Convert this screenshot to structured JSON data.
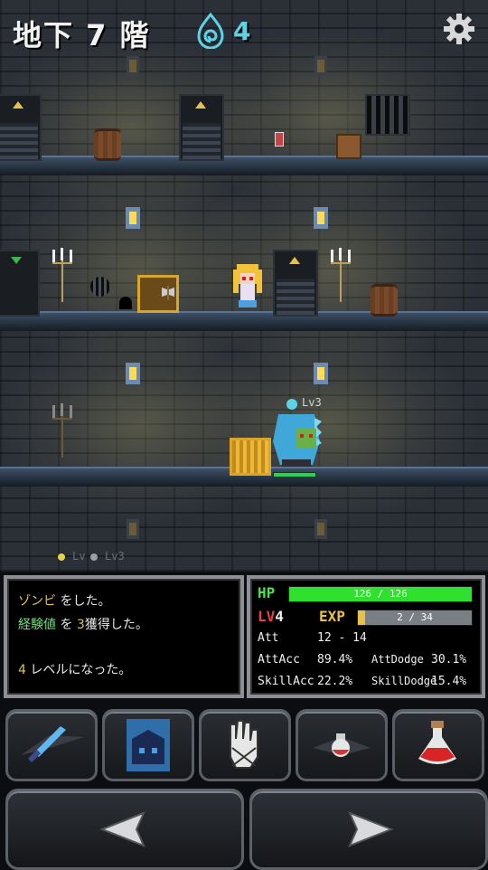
{
  "header": {
    "floor_title": "地下 7 階",
    "soul_icon": "spiral-soul-icon",
    "soul_count": "4",
    "settings_icon": "gear-icon"
  },
  "scene": {
    "enemy_label": "Lv3",
    "ghost_label_a": "Lv",
    "ghost_label_b": "Lv3"
  },
  "log": {
    "line1_name": "ゾンビ",
    "line1_rest": " をした。",
    "line2_a": "経験値",
    "line2_b": " を ",
    "line2_num": "3",
    "line2_c": "獲得した。",
    "line3_num": "4",
    "line3_rest": " レベルになった。"
  },
  "stats": {
    "hp_label": "HP",
    "hp_text": "126 / 126",
    "hp_fraction": 1.0,
    "lv_label": "LV",
    "lv_value": "4",
    "exp_label": "EXP",
    "exp_text": "2 / 34",
    "exp_fraction": 0.06,
    "att_label": "Att",
    "att_value": "12 - 14",
    "attacc_label": "AttAcc",
    "attacc_value": "89.4%",
    "attdodge_label": "AttDodge",
    "attdodge_value": "30.1%",
    "skillacc_label": "SkillAcc",
    "skillacc_value": "22.2%",
    "skilldodge_label": "SkillDodge",
    "skilldodge_value": "15.4%"
  },
  "colors": {
    "hp_green": "#2fe02f",
    "exp_bar_bg": "#7a7f85",
    "exp_fill": "#e6c24a",
    "soul_cyan": "#5fd3e6"
  },
  "slots": [
    "sword-icon",
    "armor-icon",
    "hand-icon",
    "small-potion-icon",
    "potion-icon"
  ],
  "nav": [
    "left-arrow-icon",
    "right-arrow-icon"
  ]
}
